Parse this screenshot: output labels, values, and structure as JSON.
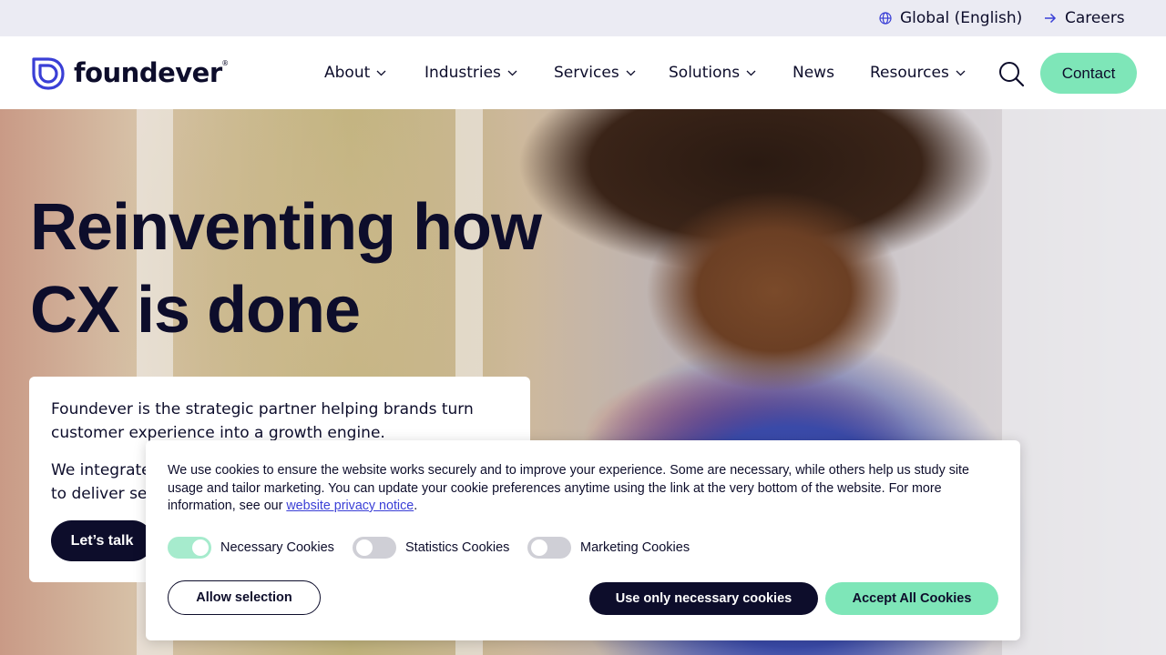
{
  "topbar": {
    "region_label": "Global (English)",
    "careers_label": "Careers",
    "region_icon": "globe-icon",
    "careers_icon": "arrow-right-icon"
  },
  "header": {
    "logo_text": "foundever",
    "logo_mark": "®",
    "nav": [
      {
        "label": "About",
        "has_dropdown": true
      },
      {
        "label": "Industries",
        "has_dropdown": true
      },
      {
        "label": "Services",
        "has_dropdown": true
      },
      {
        "label": "Solutions",
        "has_dropdown": true
      },
      {
        "label": "News",
        "has_dropdown": false
      },
      {
        "label": "Resources",
        "has_dropdown": true
      }
    ],
    "search_icon": "search-icon",
    "contact_label": "Contact"
  },
  "hero": {
    "title_line1": "Reinventing how",
    "title_line2": "CX is done",
    "paragraph1": "Foundever is the strategic partner helping brands turn customer experience into a growth engine.",
    "paragraph2": "We integrate",
    "paragraph2_line2": "to deliver sea",
    "cta_label": "Let’s talk"
  },
  "cookie_banner": {
    "text": "We use cookies to ensure the website works securely and to improve your experience. Some are necessary, while others help us study site usage and tailor marketing. You can update your cookie preferences anytime using the link at the very bottom of the website. For more information, see our",
    "link_text": "website privacy notice",
    "link_suffix": ".",
    "toggles": [
      {
        "label": "Necessary Cookies",
        "on": true
      },
      {
        "label": "Statistics Cookies",
        "on": false
      },
      {
        "label": "Marketing Cookies",
        "on": false
      }
    ],
    "allow_selection_label": "Allow selection",
    "necessary_only_label": "Use only necessary cookies",
    "accept_all_label": "Accept All Cookies"
  },
  "colors": {
    "navy": "#0d0d2b",
    "mint": "#7ee6b8",
    "topbar_bg": "#ebebf3",
    "brand_purple": "#3a3fd6"
  }
}
